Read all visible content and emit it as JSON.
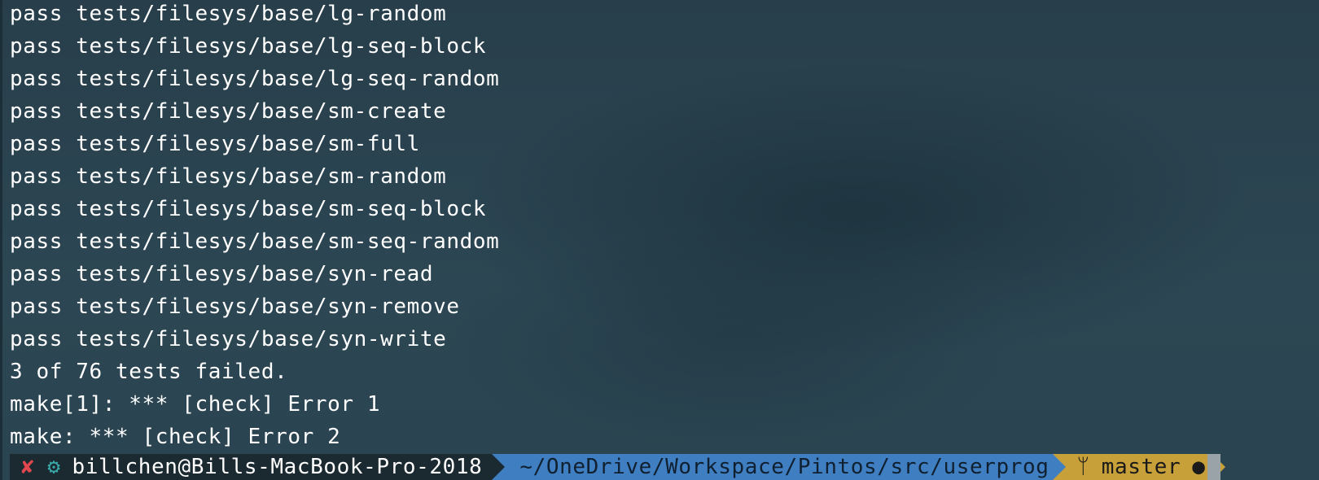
{
  "terminal": {
    "output_lines": [
      "pass tests/filesys/base/lg-random",
      "pass tests/filesys/base/lg-seq-block",
      "pass tests/filesys/base/lg-seq-random",
      "pass tests/filesys/base/sm-create",
      "pass tests/filesys/base/sm-full",
      "pass tests/filesys/base/sm-random",
      "pass tests/filesys/base/sm-seq-block",
      "pass tests/filesys/base/sm-seq-random",
      "pass tests/filesys/base/syn-read",
      "pass tests/filesys/base/syn-remove",
      "pass tests/filesys/base/syn-write",
      "3 of 76 tests failed.",
      "make[1]: *** [check] Error 1",
      "make: *** [check] Error 2"
    ]
  },
  "prompt": {
    "status_error_symbol": "✘",
    "status_gear_symbol": "⚙",
    "user_host": "billchen@Bills-MacBook-Pro-2018",
    "directory": "~/OneDrive/Workspace/Pintos/src/userprog",
    "branch_symbol": "ᛘ",
    "branch": "master",
    "dirty_symbol": "●"
  },
  "colors": {
    "background": "#2a4350",
    "text": "#ffffff",
    "context_segment": "#1b2a31",
    "dir_segment": "#3f7fc1",
    "git_segment": "#c8a03a",
    "error_symbol": "#e0474f",
    "gear_symbol": "#3aa8a8",
    "cursor": "#9aa3a7"
  },
  "icons": {
    "status_error": "error-x-icon",
    "status_gear": "gear-icon",
    "branch": "git-branch-icon",
    "dirty": "dirty-dot-icon"
  }
}
